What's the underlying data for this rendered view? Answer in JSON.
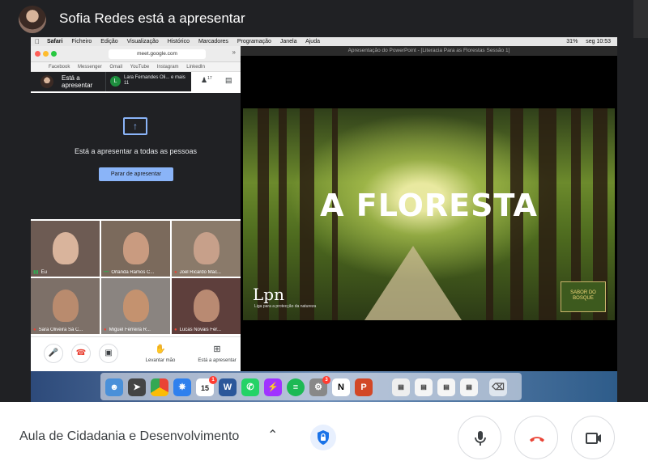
{
  "header": {
    "title": "Sofia Redes está a apresentar"
  },
  "mac_menubar": {
    "items": [
      "Safari",
      "Ficheiro",
      "Edição",
      "Visualização",
      "Histórico",
      "Marcadores",
      "Programação",
      "Janela",
      "Ajuda"
    ],
    "battery": "31%",
    "clock": "seg 10:53"
  },
  "safari": {
    "url": "meet.google.com",
    "bookmarks": [
      "Facebook",
      "Messenger",
      "Gmail",
      "YouTube",
      "Instagram",
      "LinkedIn"
    ]
  },
  "meet_panel": {
    "presenting_label": "Está a apresentar",
    "participant_label": "Lara Fernandes Oli... e mais 11",
    "participant_initial": "L",
    "people_count": "17",
    "presenting_message": "Está a apresentar a todas as pessoas",
    "stop_button": "Parar de apresentar",
    "tiles": [
      {
        "name": "Eu",
        "mic": "on"
      },
      {
        "name": "Orlanda Ramos C...",
        "mic": "on"
      },
      {
        "name": "Joel Ricardo Mac...",
        "mic": "off"
      },
      {
        "name": "Sara Oliveira Sá C...",
        "mic": "off"
      },
      {
        "name": "Miguel Ferreira R...",
        "mic": "off"
      },
      {
        "name": "Lucas Novais Fer...",
        "mic": "off"
      }
    ],
    "controls": {
      "raise_hand": "Levantar mão",
      "presenting": "Está a apresentar"
    }
  },
  "powerpoint": {
    "window_title": "Apresentação do PowerPoint - [Literacia Para as Florestas Sessão 1]",
    "slide_title": "A FLORESTA",
    "logo_text": "Lpn",
    "logo_tagline": "Liga para a protecção da natureza",
    "badge_text": "SABOR DO BOSQUE"
  },
  "dock": {
    "calendar_month": "JUL",
    "calendar_day": "15",
    "calendar_badge": "1",
    "settings_badge": "3"
  },
  "bottom_bar": {
    "meeting_title": "Aula de Cidadania e Desenvolvimento"
  },
  "colors": {
    "meet_dark": "#202124",
    "meet_blue": "#8ab4f8",
    "hangup_red": "#ea4335",
    "security_blue": "#1a73e8"
  }
}
